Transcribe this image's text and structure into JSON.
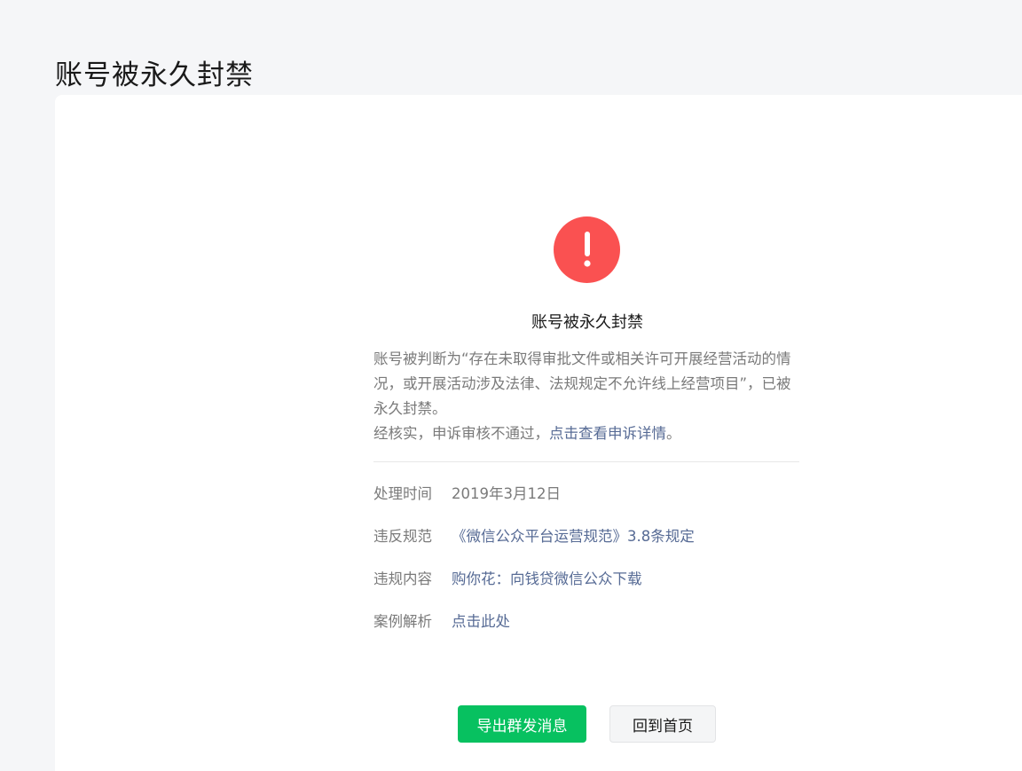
{
  "page": {
    "title": "账号被永久封禁"
  },
  "notice": {
    "icon": "exclamation-icon",
    "icon_color": "#fa5151",
    "title": "账号被永久封禁",
    "description": "账号被判断为“存在未取得审批文件或相关许可开展经营活动的情况，或开展活动涉及法律、法规规定不允许线上经营项目”，已被永久封禁。",
    "review_prefix": "经核实，申诉审核不通过，",
    "review_link": "点击查看申诉详情",
    "review_suffix": "。"
  },
  "info": [
    {
      "label": "处理时间",
      "value": "2019年3月12日"
    },
    {
      "label": "违反规范",
      "value": "《微信公众平台运营规范》3.8条规定"
    },
    {
      "label": "违规内容",
      "value": "购你花：向钱贷微信公众下载"
    },
    {
      "label": "案例解析",
      "value": "点击此处"
    }
  ],
  "actions": {
    "primary": "导出群发消息",
    "secondary": "回到首页"
  },
  "colors": {
    "brand_green": "#07c160",
    "link": "#576b95",
    "danger": "#fa5151"
  }
}
